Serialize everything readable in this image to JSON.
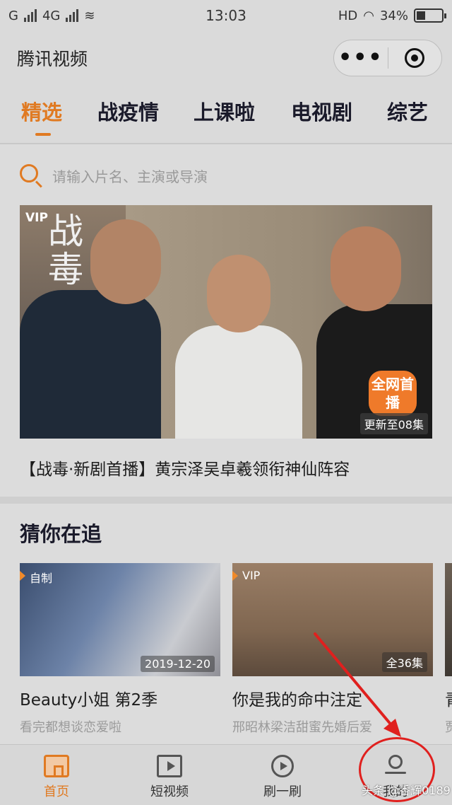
{
  "status_bar": {
    "carrier_left": "G",
    "network": "4G",
    "time": "13:03",
    "hd": "HD",
    "battery": "34%"
  },
  "title_bar": {
    "title": "腾讯视频",
    "more_label": "•••"
  },
  "tabs": [
    {
      "label": "精选",
      "active": true
    },
    {
      "label": "战疫情",
      "active": false
    },
    {
      "label": "上课啦",
      "active": false
    },
    {
      "label": "电视剧",
      "active": false
    },
    {
      "label": "综艺",
      "active": false
    }
  ],
  "search": {
    "placeholder": "请输入片名、主演或导演"
  },
  "hero": {
    "vip": "VIP",
    "logo": "战毒",
    "badge": "全网首播",
    "update": "更新至08集",
    "caption": "【战毒·新剧首播】黄宗泽吴卓羲领衔神仙阵容"
  },
  "section": {
    "title": "猜你在追"
  },
  "cards": [
    {
      "tag": "自制",
      "badge": "2019-12-20",
      "title": "Beauty小姐 第2季",
      "subtitle": "看完都想谈恋爱啦"
    },
    {
      "tag": "VIP",
      "badge": "全36集",
      "title": "你是我的命中注定",
      "subtitle": "邢昭林梁洁甜蜜先婚后爱"
    },
    {
      "tag": "",
      "badge": "",
      "title": "青",
      "subtitle": "贾"
    }
  ],
  "bottom_nav": [
    {
      "label": "首页",
      "icon": "home-icon",
      "active": true
    },
    {
      "label": "短视频",
      "icon": "video-icon",
      "active": false
    },
    {
      "label": "刷一刷",
      "icon": "flip-icon",
      "active": false
    },
    {
      "label": "我的",
      "icon": "me-icon",
      "active": false
    }
  ],
  "watermark": "头条 @香辉0189",
  "colors": {
    "accent": "#e07a22",
    "annotation": "#e0201e"
  }
}
